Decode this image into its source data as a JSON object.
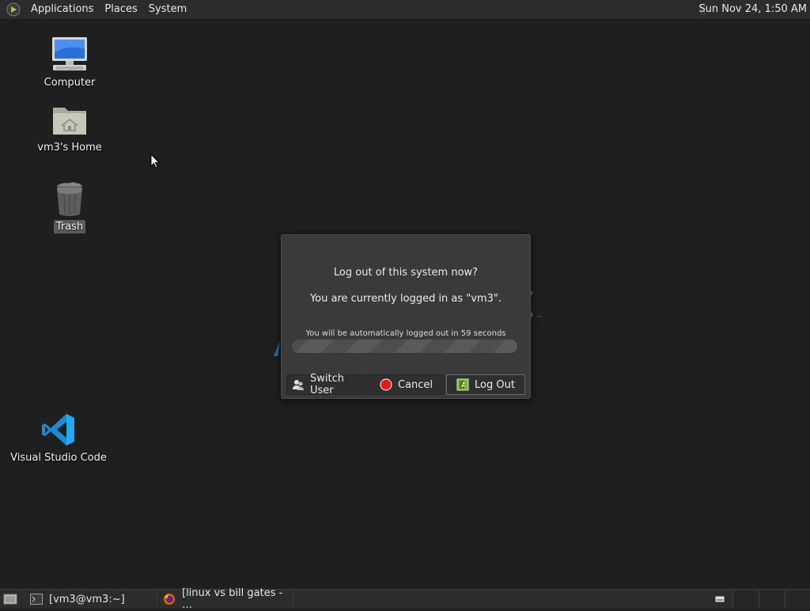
{
  "top_panel": {
    "menus": [
      "Applications",
      "Places",
      "System"
    ],
    "clock": "Sun Nov 24,  1:50 AM"
  },
  "desktop": {
    "icons": [
      {
        "label": "Computer",
        "icon": "computer-icon"
      },
      {
        "label": "vm3's Home",
        "icon": "home-folder-icon"
      },
      {
        "label": "Trash",
        "icon": "trash-icon"
      },
      {
        "label": "Visual Studio Code",
        "icon": "vscode-icon"
      }
    ]
  },
  "dialog": {
    "question": "Log out of this system now?",
    "status": "You are currently logged in as \"vm3\".",
    "countdown": "You will be automatically logged out in 59 seconds",
    "progress_fraction": 0.995,
    "buttons": {
      "switch_user": "Switch User",
      "cancel": "Cancel",
      "log_out": "Log Out"
    }
  },
  "taskbar": {
    "tasks": [
      {
        "label": "[vm3@vm3:~]",
        "icon": "terminal-icon"
      },
      {
        "label": "[linux vs bill gates - …",
        "icon": "firefox-icon"
      }
    ]
  },
  "colors": {
    "desktop_bg": "#1f1f1f",
    "panel_bg": "#2c2c2c",
    "dialog_bg": "#3a3a3a",
    "vscode_blue": "#23a9f2",
    "cancel_red": "#e01b1b",
    "logout_green": "#7ab830"
  }
}
